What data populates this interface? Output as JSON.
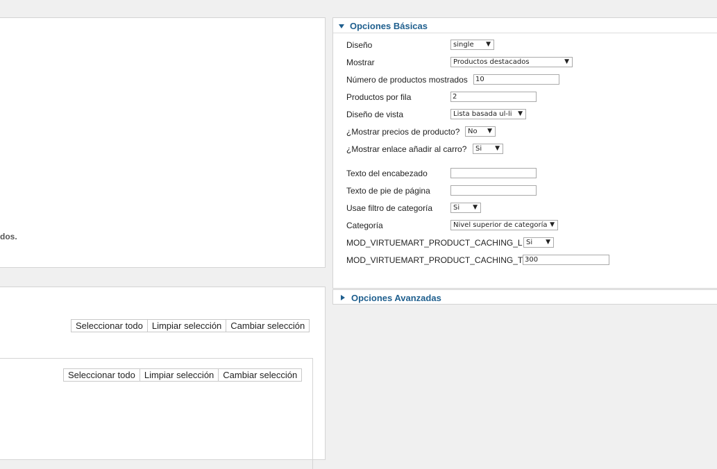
{
  "left": {
    "truncated_text": "dos.",
    "selection_buttons_a": [
      "Seleccionar todo",
      "Limpiar selección",
      "Cambiar selección"
    ],
    "selection_buttons_b": [
      "Seleccionar todo",
      "Limpiar selección",
      "Cambiar selección"
    ]
  },
  "basic": {
    "title": "Opciones Básicas",
    "rows": [
      {
        "label": "Diseño",
        "type": "select",
        "value": "single"
      },
      {
        "label": "Mostrar",
        "type": "select",
        "value": "Productos destacados"
      },
      {
        "label": "Número de productos mostrados",
        "type": "input",
        "value": "10"
      },
      {
        "label": "Productos por fila",
        "type": "input",
        "value": "2"
      },
      {
        "label": "Diseño de vista",
        "type": "select",
        "value": "Lista basada ul-li"
      },
      {
        "label": "¿Mostrar precios de producto?",
        "type": "select",
        "value": "No"
      },
      {
        "label": "¿Mostrar enlace añadir al carro?",
        "type": "select",
        "value": "Si"
      },
      {
        "label": "Texto del encabezado",
        "type": "input",
        "value": ""
      },
      {
        "label": "Texto de pie de página",
        "type": "input",
        "value": ""
      },
      {
        "label": "Usae filtro de categoría",
        "type": "select",
        "value": "Si"
      },
      {
        "label": "Categoría",
        "type": "select",
        "value": "Nivel superior de categoría"
      },
      {
        "label": "MOD_VIRTUEMART_PRODUCT_CACHING_L",
        "type": "select",
        "value": "Si"
      },
      {
        "label": "MOD_VIRTUEMART_PRODUCT_CACHING_T",
        "type": "input",
        "value": "300"
      }
    ]
  },
  "advanced": {
    "title": "Opciones Avanzadas"
  },
  "icons": {
    "expanded": "triangle-down-icon",
    "collapsed": "triangle-right-icon",
    "select_arrow": "▼"
  },
  "colors": {
    "section_title": "#1f5f8e",
    "panel_bg": "#ffffff",
    "page_bg": "#f0f0f0"
  }
}
